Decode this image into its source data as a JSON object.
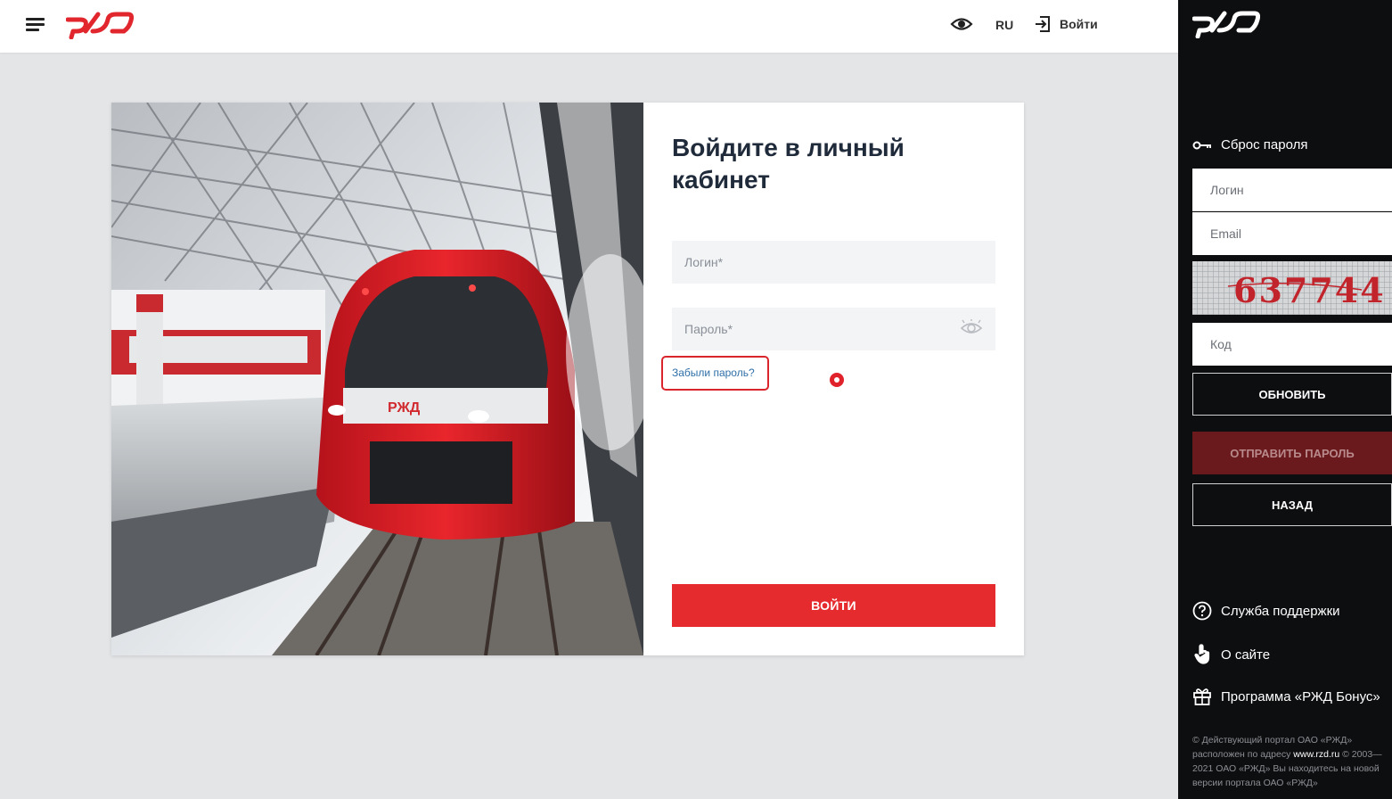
{
  "header": {
    "lang": "RU",
    "login_label": "Войти"
  },
  "main": {
    "title": "Войдите в личный кабинет",
    "login_placeholder": "Логин*",
    "password_placeholder": "Пароль*",
    "forgot_link": "Забыли пароль?",
    "submit_label": "ВОЙТИ"
  },
  "panel": {
    "reset_title": "Сброс пароля",
    "login_placeholder": "Логин",
    "email_placeholder": "Email",
    "captcha_text": "637744",
    "code_placeholder": "Код",
    "refresh_label": "ОБНОВИТЬ",
    "send_label": "ОТПРАВИТЬ ПАРОЛЬ",
    "back_label": "НАЗАД",
    "links": {
      "support": "Служба поддержки",
      "about": "О сайте",
      "bonus": "Программа «РЖД Бонус»"
    },
    "footer": {
      "line1": "© Действующий портал ОАО «РЖД» расположен по адресу",
      "site": "www.rzd.ru",
      "line2": "© 2003—2021 ОАО «РЖД»",
      "line3": "Вы находитесь на новой версии портала ОАО «РЖД»"
    }
  },
  "icons": {
    "menu": "menu-icon",
    "eye": "eye-icon",
    "login": "login-icon",
    "key": "key-icon",
    "help": "help-circle-icon",
    "hand": "hand-pointer-icon",
    "gift": "gift-icon"
  },
  "colors": {
    "brand_red": "#e52b2e",
    "panel_bg": "#0d0e10",
    "link_blue": "#2f6fa8",
    "page_bg": "#e4e5e7"
  }
}
